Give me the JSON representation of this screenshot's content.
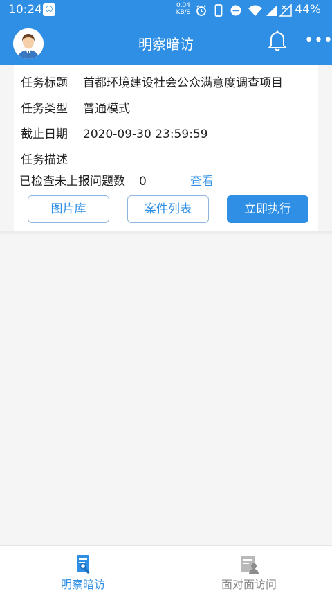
{
  "status_bar": {
    "time": "10:24",
    "net_speed": "0.04",
    "net_unit": "KB/S",
    "battery": "44%"
  },
  "header": {
    "title": "明察暗访"
  },
  "task": {
    "title_label": "任务标题",
    "title_value": "首都环境建设社会公众满意度调查项目",
    "type_label": "任务类型",
    "type_value": "普通模式",
    "deadline_label": "截止日期",
    "deadline_value": "2020-09-30 23:59:59",
    "desc_label": "任务描述",
    "unreported_label": "已检查未上报问题数",
    "unreported_value": "0",
    "view_label": "查看"
  },
  "buttons": {
    "gallery": "图片库",
    "case_list": "案件列表",
    "execute": "立即执行"
  },
  "tabs": [
    {
      "label": "明察暗访",
      "icon": "inspection-icon",
      "active": true
    },
    {
      "label": "面对面访问",
      "icon": "interview-icon",
      "active": false
    }
  ],
  "colors": {
    "primary": "#2f8fe4",
    "inactive": "#888888"
  }
}
